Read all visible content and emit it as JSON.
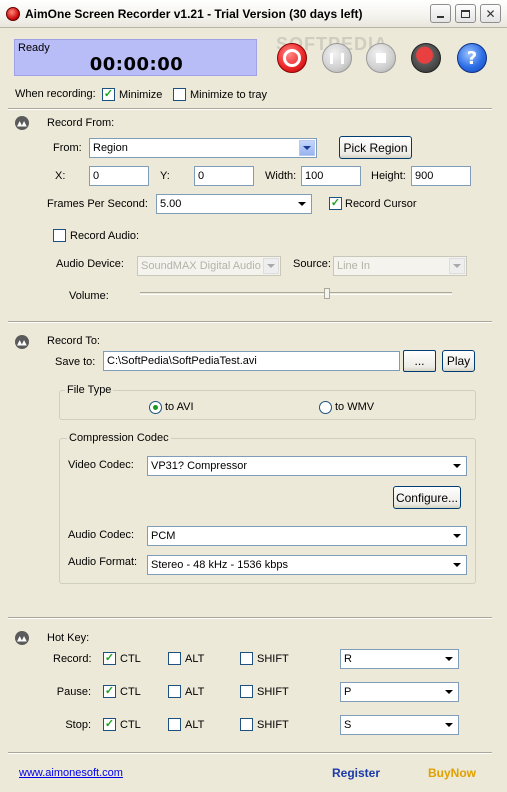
{
  "window": {
    "title": "AimOne Screen Recorder v1.21 - Trial Version (30 days left)"
  },
  "status": {
    "text": "Ready",
    "timer": "00:00:00"
  },
  "toolbar": {
    "help_glyph": "?"
  },
  "watermark": "SOFTPEDIA",
  "when_recording": {
    "label": "When recording:",
    "minimize_label": "Minimize",
    "minimize_checked": true,
    "tray_label": "Minimize to tray",
    "tray_checked": false
  },
  "record_from": {
    "header": "Record From:",
    "from_label": "From:",
    "from_value": "Region",
    "pick_region_label": "Pick Region",
    "x_label": "X:",
    "x_value": "0",
    "y_label": "Y:",
    "y_value": "0",
    "width_label": "Width:",
    "width_value": "100",
    "height_label": "Height:",
    "height_value": "900",
    "fps_label": "Frames Per Second:",
    "fps_value": "5.00",
    "record_cursor_label": "Record Cursor",
    "record_cursor_checked": true,
    "record_audio_label": "Record Audio:",
    "record_audio_checked": false,
    "audio_device_label": "Audio Device:",
    "audio_device_value": "SoundMAX Digital Audio",
    "source_label": "Source:",
    "source_value": "Line In",
    "volume_label": "Volume:",
    "volume_level": 0.6
  },
  "record_to": {
    "header": "Record To:",
    "save_to_label": "Save to:",
    "save_to_value": "C:\\SoftPedia\\SoftPediaTest.avi",
    "browse_label": "...",
    "play_label": "Play",
    "file_type_title": "File Type",
    "avi_label": "to AVI",
    "wmv_label": "to WMV",
    "selected_type": "avi",
    "compression_title": "Compression Codec",
    "video_codec_label": "Video Codec:",
    "video_codec_value": "VP31? Compressor",
    "configure_label": "Configure...",
    "audio_codec_label": "Audio Codec:",
    "audio_codec_value": "PCM",
    "audio_format_label": "Audio Format:",
    "audio_format_value": "Stereo - 48 kHz - 1536 kbps"
  },
  "hotkey": {
    "header": "Hot Key:",
    "ctl_label": "CTL",
    "alt_label": "ALT",
    "shift_label": "SHIFT",
    "rows": [
      {
        "label": "Record:",
        "ctl": true,
        "alt": false,
        "shift": false,
        "key": "R"
      },
      {
        "label": "Pause:",
        "ctl": true,
        "alt": false,
        "shift": false,
        "key": "P"
      },
      {
        "label": "Stop:",
        "ctl": true,
        "alt": false,
        "shift": false,
        "key": "S"
      }
    ]
  },
  "footer": {
    "website": "www.aimonesoft.com",
    "register": "Register",
    "buy_now": "BuyNow"
  },
  "colors": {
    "status_bg": "#b8bcf7",
    "window_bg": "#ece9d8",
    "register": "#1a3aa8",
    "buy_now": "#e0a000"
  }
}
